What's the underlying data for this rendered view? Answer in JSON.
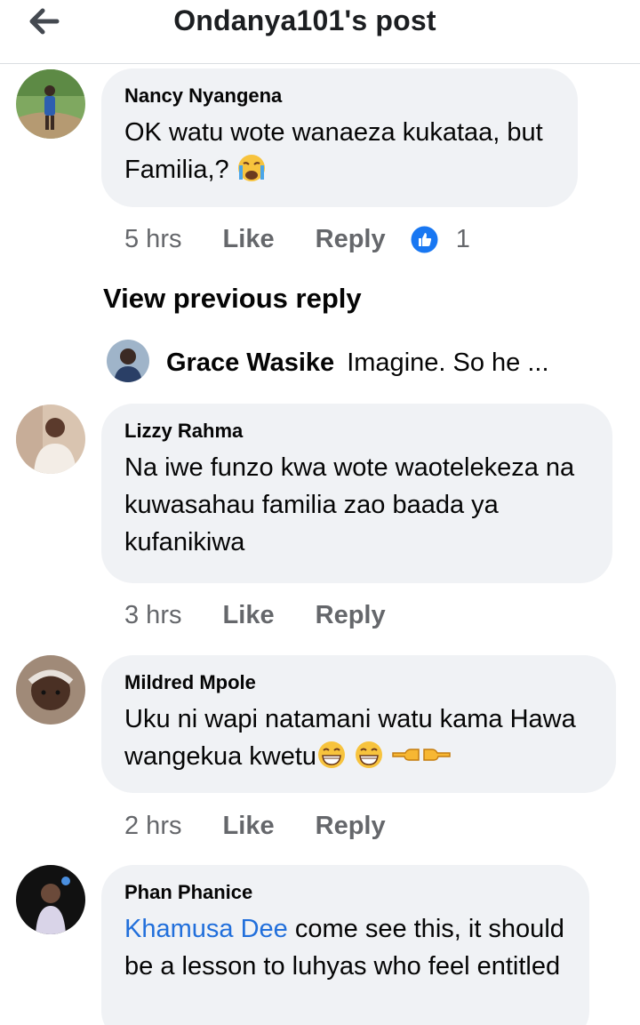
{
  "header": {
    "title": "Ondanya101's post",
    "back_icon": "arrow-left-icon"
  },
  "comments": [
    {
      "name": "Nancy Nyangena",
      "text": "OK watu wote wanaeza kukataa, but Familia,?",
      "emoji": "loudly-crying-face",
      "time": "5 hrs",
      "like": "Like",
      "reply": "Reply",
      "reaction_icon": "like-reaction-icon",
      "reaction_count": "1"
    },
    {
      "name": "Lizzy Rahma",
      "text": "Na iwe funzo kwa wote waotelekeza na kuwasahau familia zao baada ya kufanikiwa",
      "time": "3 hrs",
      "like": "Like",
      "reply": "Reply"
    },
    {
      "name": "Mildred Mpole",
      "text": "Uku ni wapi natamani watu kama Hawa wangekua kwetu",
      "emojis": [
        "grinning-face",
        "grinning-face",
        "left-pointing-hand",
        "right-pointing-hand"
      ],
      "time": "2 hrs",
      "like": "Like",
      "reply": "Reply"
    },
    {
      "name": "Phan Phanice",
      "mention": "Khamusa Dee",
      "text": "come see this, it should be a lesson to luhyas who feel entitled"
    }
  ],
  "view_previous": "View previous reply",
  "reply_preview": {
    "name": "Grace Wasike",
    "snippet": "Imagine. So he ..."
  },
  "colors": {
    "bubble": "#f0f2f5",
    "meta": "#65676b",
    "link": "#216fdb",
    "like_blue": "#1877f2"
  }
}
